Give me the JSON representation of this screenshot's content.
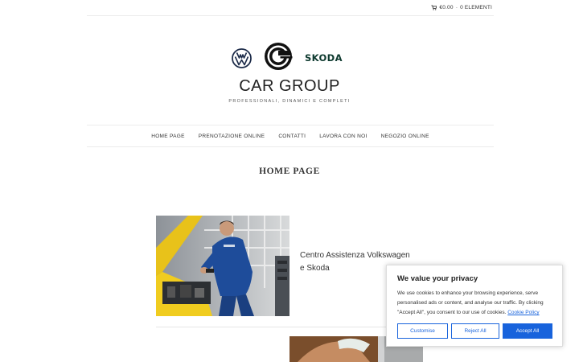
{
  "header": {
    "cart_price": "€0.00",
    "cart_separator": "-",
    "cart_items": "0 ELEMENTI"
  },
  "branding": {
    "title": "CAR GROUP",
    "tagline": "PROFESSIONALI, DINAMICI E COMPLETI",
    "skoda_text": "SKODA",
    "logos": [
      "volkswagen-logo",
      "car-group-logo",
      "skoda-logo"
    ]
  },
  "nav": {
    "items": [
      {
        "label": "HOME PAGE"
      },
      {
        "label": "PRENOTAZIONE ONLINE"
      },
      {
        "label": "CONTATTI"
      },
      {
        "label": "LAVORA CON NOI"
      },
      {
        "label": "NEGOZIO ONLINE"
      }
    ]
  },
  "main": {
    "page_title": "HOME PAGE",
    "feature": {
      "line1": "Centro Assistenza Volkswagen",
      "line2": "e Skoda"
    }
  },
  "cookie": {
    "title": "We value your privacy",
    "body": "We use cookies to enhance your browsing experience, serve personalised ads or content, and analyse our traffic. By clicking \"Accept All\", you consent to our use of cookies.",
    "policy_link": "Cookie Policy",
    "customise": "Customise",
    "reject": "Reject All",
    "accept": "Accept All"
  },
  "colors": {
    "accent": "#1863dc",
    "skoda_green": "#0e3a2f"
  }
}
